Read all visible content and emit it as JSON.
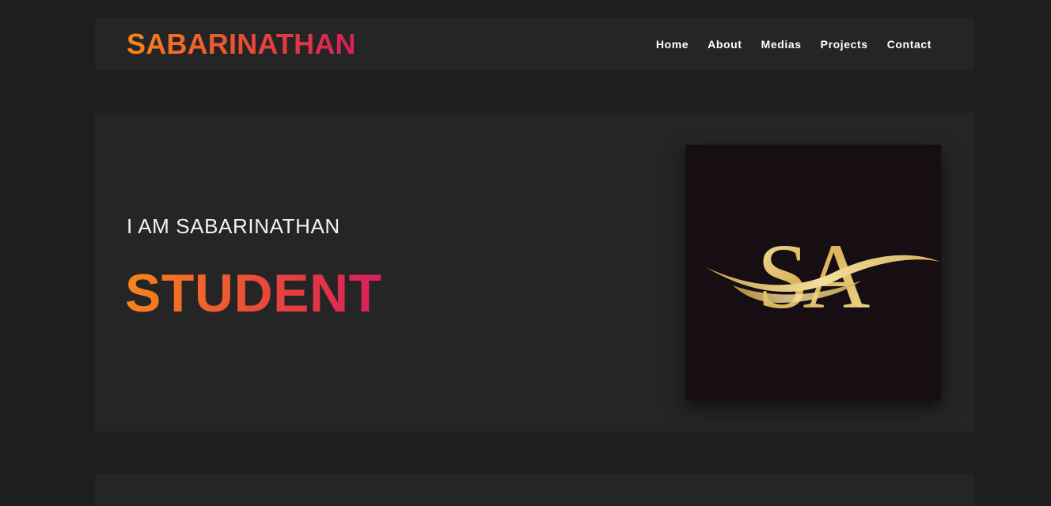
{
  "header": {
    "brand": "SABARINATHAN",
    "nav": [
      {
        "label": "Home"
      },
      {
        "label": "About"
      },
      {
        "label": "Medias"
      },
      {
        "label": "Projects"
      },
      {
        "label": "Contact"
      }
    ]
  },
  "hero": {
    "intro": "I AM SABARINATHAN",
    "role": "STUDENT",
    "logo": {
      "monogram": "SA",
      "icon": "sa-monogram-logo"
    }
  },
  "colors": {
    "page_background": "#1f1f1f",
    "panel_background": "#252525",
    "gradient_start": "#f7851c",
    "gradient_end": "#d81e5b",
    "logo_background": "#160e12",
    "logo_gold": "#e8c96a"
  }
}
